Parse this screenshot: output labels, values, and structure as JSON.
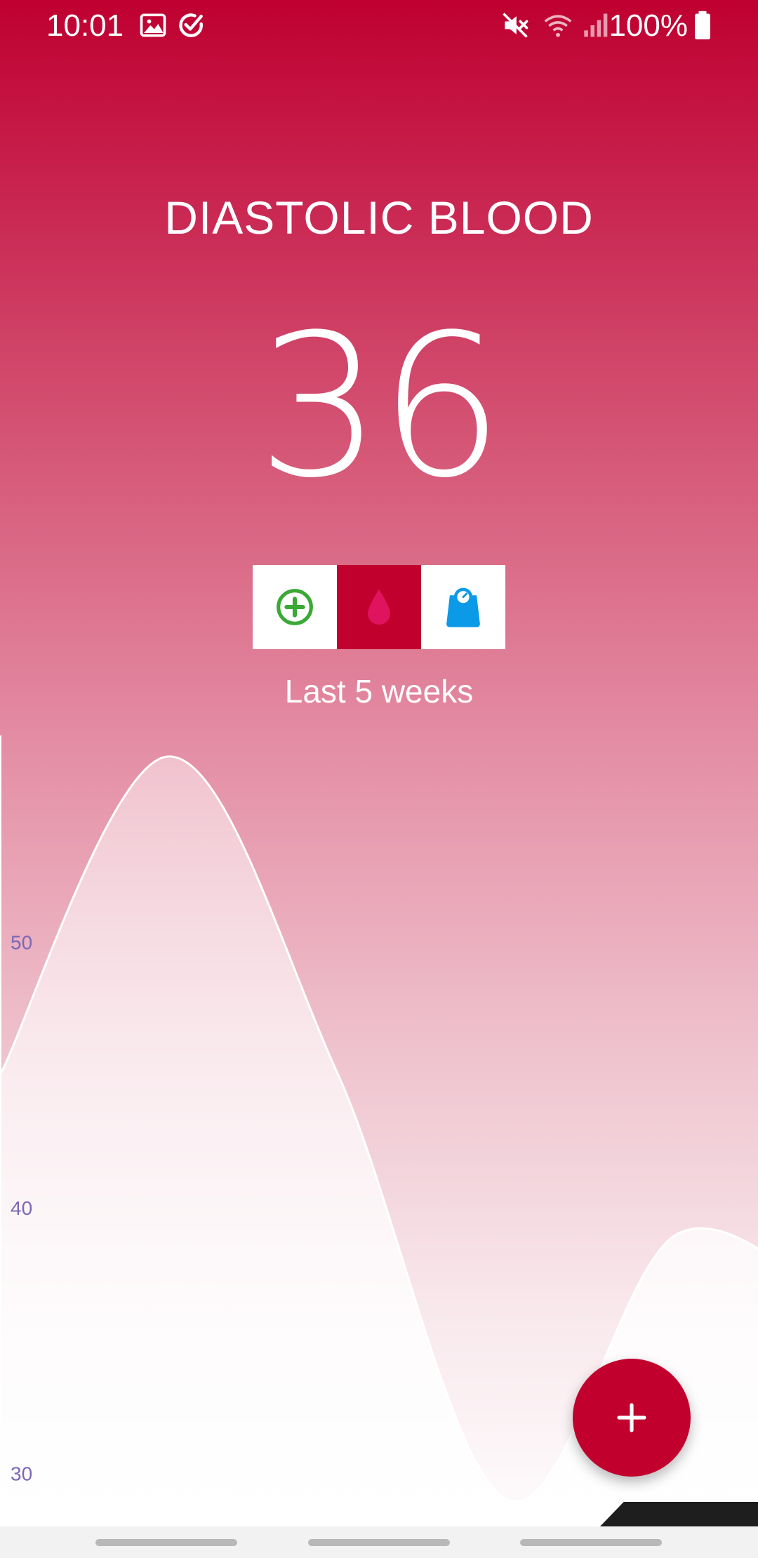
{
  "status_bar": {
    "time": "10:01",
    "battery": "100%",
    "icons": [
      "image-icon",
      "check-circle-icon",
      "mute-icon",
      "wifi-icon",
      "signal-icon",
      "battery-icon"
    ]
  },
  "header": {
    "title": "DIASTOLIC BLOOD",
    "value": "36"
  },
  "metric_tabs": [
    {
      "icon": "add-circle-icon",
      "active": false,
      "color": "#3aa935"
    },
    {
      "icon": "blood-drop-icon",
      "active": true,
      "color": "#e0135f"
    },
    {
      "icon": "weight-scale-icon",
      "active": false,
      "color": "#0b9ae8"
    }
  ],
  "range_label": "Last 5 weeks",
  "chart_data": {
    "type": "area",
    "y_ticks": [
      "50",
      "40",
      "30"
    ],
    "series": [
      {
        "values": [
          45,
          57,
          45,
          29,
          39,
          36
        ]
      }
    ],
    "ylim": [
      28,
      58
    ],
    "grid": false,
    "colors": {
      "tick": "#7b68b5",
      "line": "#ffffff"
    }
  },
  "fab": {
    "icon": "plus-icon"
  },
  "colors": {
    "primary": "#c1002e",
    "accent_green": "#3aa935",
    "accent_blue": "#0b9ae8"
  }
}
